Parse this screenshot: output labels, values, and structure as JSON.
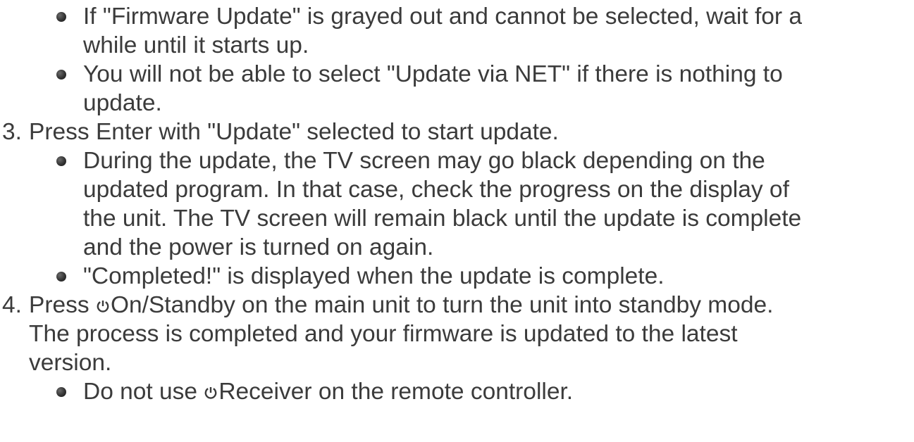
{
  "doc": {
    "bullets_top": [
      {
        "lines": [
          "If \"Firmware Update\" is grayed out and cannot be selected, wait for a",
          "while until it starts up."
        ]
      },
      {
        "lines": [
          "You will not be able to select \"Update via NET\" if there is nothing to",
          "update."
        ]
      }
    ],
    "step3": {
      "number": "3.",
      "text": "Press Enter with \"Update\" selected to start update.",
      "bullets": [
        {
          "lines": [
            "During the update, the TV screen may go black depending on the",
            "updated program. In that case, check the progress on the display of",
            "the unit. The TV screen will remain black until the update is complete",
            "and the power is turned on again."
          ]
        },
        {
          "lines": [
            "\"Completed!\" is displayed when the update is complete."
          ]
        }
      ]
    },
    "step4": {
      "number": "4.",
      "line1_prefix": "Press ",
      "line1_rest": "On/Standby on the main unit to turn the unit into standby mode.",
      "lines_more": [
        "The process is completed and your firmware is updated to the latest",
        "version."
      ],
      "bullet_prefix": "Do not use ",
      "bullet_rest": "Receiver on the remote controller.",
      "icon": "power-icon"
    }
  }
}
